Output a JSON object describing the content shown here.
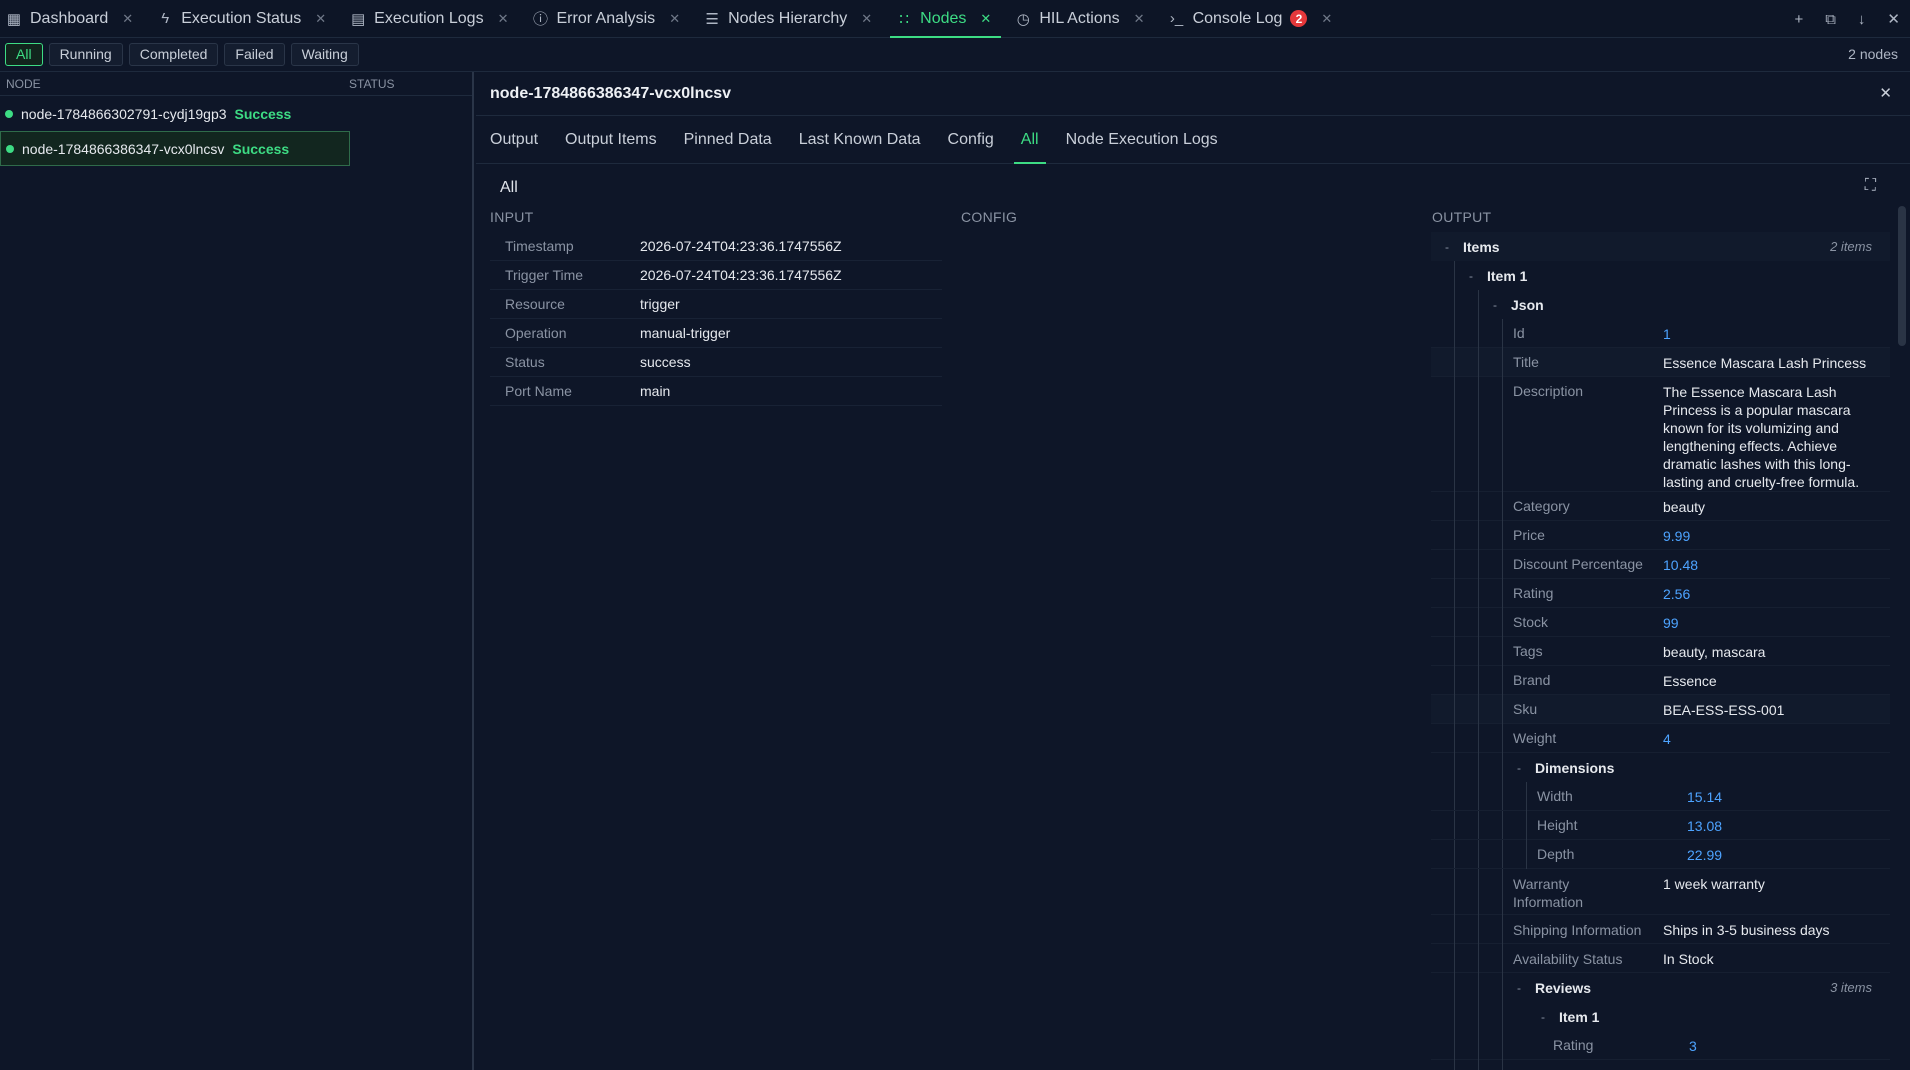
{
  "tabs": [
    {
      "label": "Dashboard",
      "icon": "grid-icon",
      "glyph": "▦",
      "active": false,
      "badge": null
    },
    {
      "label": "Execution Status",
      "icon": "bolt-icon",
      "glyph": "ϟ",
      "active": false,
      "badge": null
    },
    {
      "label": "Execution Logs",
      "icon": "clipboard-icon",
      "glyph": "▤",
      "active": false,
      "badge": null
    },
    {
      "label": "Error Analysis",
      "icon": "alert-circle-icon",
      "glyph": "ⓘ",
      "active": false,
      "badge": null
    },
    {
      "label": "Nodes Hierarchy",
      "icon": "list-icon",
      "glyph": "☰",
      "active": false,
      "badge": null
    },
    {
      "label": "Nodes",
      "icon": "nodes-icon",
      "glyph": "∷",
      "active": true,
      "badge": null
    },
    {
      "label": "HIL Actions",
      "icon": "clock-icon",
      "glyph": "◷",
      "active": false,
      "badge": null
    },
    {
      "label": "Console Log",
      "icon": "terminal-icon",
      "glyph": "›_",
      "active": false,
      "badge": "2"
    }
  ],
  "filters": {
    "items": [
      "All",
      "Running",
      "Completed",
      "Failed",
      "Waiting"
    ],
    "active": "All",
    "node_count": "2 nodes"
  },
  "node_list": {
    "col_node": "NODE",
    "col_status": "STATUS",
    "rows": [
      {
        "name": "node-1784866302791-cydj19gp3",
        "status": "Success",
        "selected": false
      },
      {
        "name": "node-1784866386347-vcx0lncsv",
        "status": "Success",
        "selected": true
      }
    ]
  },
  "detail": {
    "title": "node-1784866386347-vcx0lncsv",
    "subtabs": [
      "Output",
      "Output Items",
      "Pinned Data",
      "Last Known Data",
      "Config",
      "All",
      "Node Execution Logs"
    ],
    "active_subtab": "All",
    "section_title": "All",
    "col_input": "INPUT",
    "col_config": "CONFIG",
    "col_output": "OUTPUT",
    "input": [
      {
        "k": "Timestamp",
        "v": "2026-07-24T04:23:36.1747556Z"
      },
      {
        "k": "Trigger Time",
        "v": "2026-07-24T04:23:36.1747556Z"
      },
      {
        "k": "Resource",
        "v": "trigger"
      },
      {
        "k": "Operation",
        "v": "manual-trigger"
      },
      {
        "k": "Status",
        "v": "success"
      },
      {
        "k": "Port Name",
        "v": "main"
      }
    ]
  },
  "output": {
    "items_label": "Items",
    "items_count": "2 items",
    "item1_label": "Item 1",
    "json_label": "Json",
    "fields": [
      {
        "k": "Id",
        "v": "1",
        "num": true
      },
      {
        "k": "Title",
        "v": "Essence Mascara Lash Princess",
        "num": false
      },
      {
        "k": "Description",
        "v": "The Essence Mascara Lash Princess is a popular mascara known for its volumizing and lengthening effects. Achieve dramatic lashes with this long-lasting and cruelty-free formula.",
        "num": false
      },
      {
        "k": "Category",
        "v": "beauty",
        "num": false
      },
      {
        "k": "Price",
        "v": "9.99",
        "num": true
      },
      {
        "k": "Discount Percentage",
        "v": "10.48",
        "num": true
      },
      {
        "k": "Rating",
        "v": "2.56",
        "num": true
      },
      {
        "k": "Stock",
        "v": "99",
        "num": true
      },
      {
        "k": "Tags",
        "v": "beauty, mascara",
        "num": false
      },
      {
        "k": "Brand",
        "v": "Essence",
        "num": false
      },
      {
        "k": "Sku",
        "v": "BEA-ESS-ESS-001",
        "num": false
      },
      {
        "k": "Weight",
        "v": "4",
        "num": true
      }
    ],
    "dimensions_label": "Dimensions",
    "dimensions": [
      {
        "k": "Width",
        "v": "15.14"
      },
      {
        "k": "Height",
        "v": "13.08"
      },
      {
        "k": "Depth",
        "v": "22.99"
      }
    ],
    "fields2": [
      {
        "k": "Warranty Information",
        "v": "1 week warranty"
      },
      {
        "k": "Shipping Information",
        "v": "Ships in 3-5 business days"
      },
      {
        "k": "Availability Status",
        "v": "In Stock"
      }
    ],
    "reviews_label": "Reviews",
    "reviews_count": "3 items",
    "review_item_label": "Item 1",
    "review_rating_k": "Rating",
    "review_rating_v": "3"
  },
  "colors": {
    "accent": "#3ddc84",
    "background": "#0e1628",
    "number": "#4da3ff",
    "badge": "#e5383b"
  }
}
